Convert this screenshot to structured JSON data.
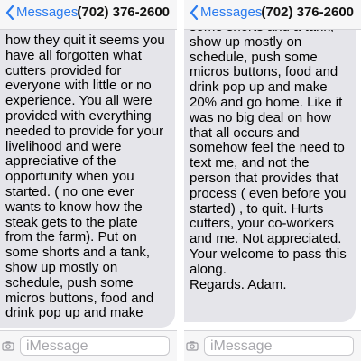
{
  "left": {
    "back_label": "Messages",
    "contact": "(702) 376-2600",
    "message": "how they quit it seems you\nhave all forgotten what\ncutters provided for\neveryone with little or no\nexperience. You all were\nprovided with everything\nneeded to provide for your\nlivelihood and were\nappreciative of the\nopportunity when you\nstarted. ( no one ever\nwants to know how the\nsteak gets to the plate\nfrom the farm). Put on\nsome shorts and a tank,\nshow up mostly on\nschedule, push some\nmicros buttons, food and\ndrink pop up and make",
    "input_placeholder": "iMessage"
  },
  "right": {
    "back_label": "Messages",
    "contact": "(702) 376-2600",
    "message": "some shorts and a tank,\nshow up mostly on\nschedule, push some\nmicros buttons, food and\ndrink pop up and make\n20% and go home. Like it\nwas no big deal on how\nthat all occurs and\nsomehow feel the need to\ntext me, and not the\nperson that provides that\nprocess ( even before you\nstarted) , to quit.  Hurts\ncutters, your co-workers\nand me.  Not appreciated.\nYour welcome to pass this\nalong.\nRegards.  Adam.",
    "input_placeholder": "iMessage"
  },
  "colors": {
    "accent": "#2a7bef",
    "bubble": "#e5e5ea",
    "bar": "#f6f6f7"
  },
  "icons": {
    "back": "chevron-left-icon",
    "camera": "camera-icon"
  }
}
